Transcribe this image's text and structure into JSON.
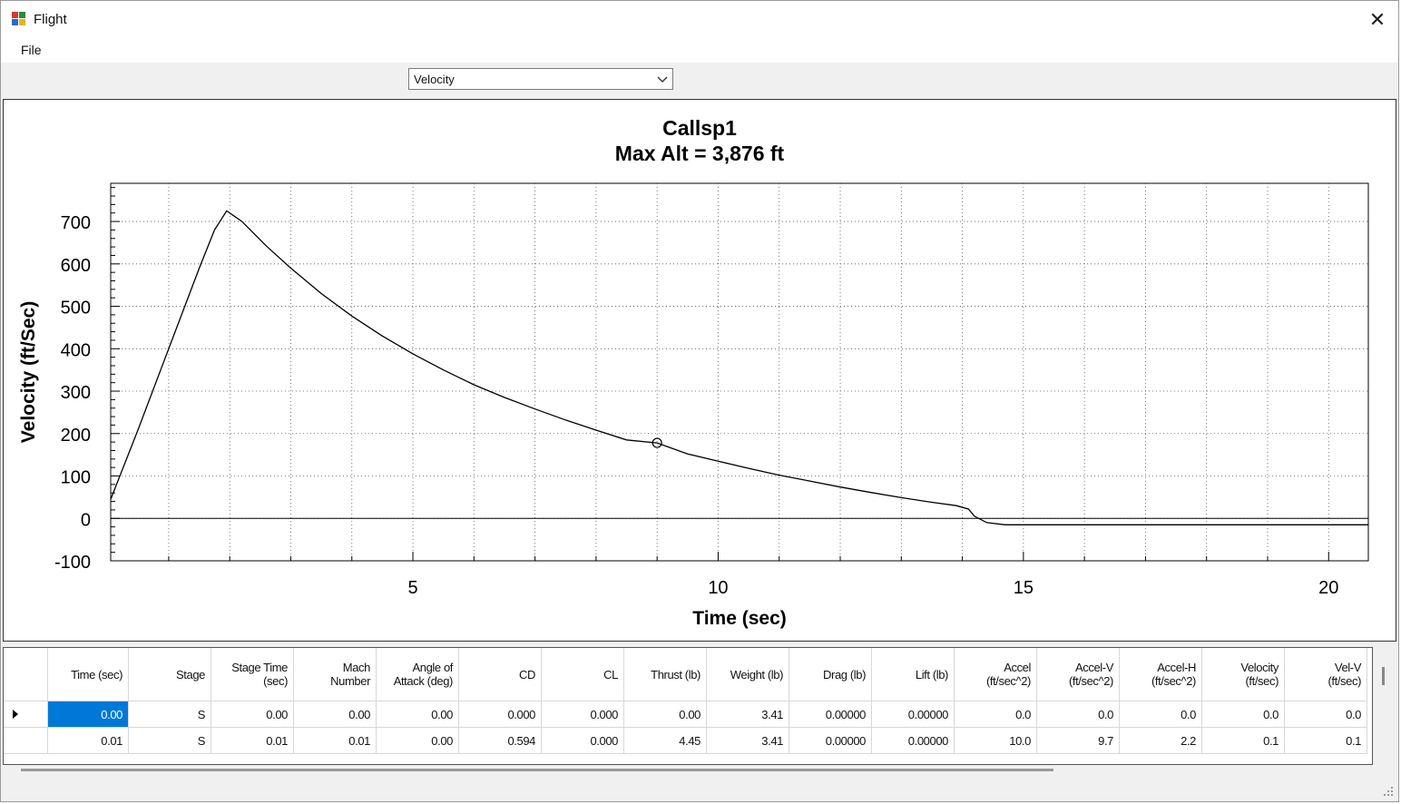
{
  "window": {
    "title": "Flight",
    "close_glyph": "✕"
  },
  "menu": {
    "file": "File"
  },
  "toolbar": {
    "plot_select": {
      "value": "Velocity"
    }
  },
  "chart_data": {
    "type": "line",
    "title": "Callsp1",
    "subtitle": "Max Alt = 3,876 ft",
    "xlabel": "Time (sec)",
    "ylabel": "Velocity (ft/Sec)",
    "xlim": [
      0.05,
      20.65
    ],
    "ylim": [
      -100,
      790
    ],
    "x_ticks": [
      5,
      10,
      15,
      20
    ],
    "y_ticks": [
      -100,
      0,
      100,
      200,
      300,
      400,
      500,
      600,
      700
    ],
    "grid": true,
    "zero_line": true,
    "series": [
      {
        "x": [
          0.05,
          0.5,
          1.0,
          1.5,
          1.75,
          1.95,
          2.2,
          2.6,
          3.0,
          3.5,
          4.0,
          4.5,
          5.0,
          5.5,
          6.0,
          6.5,
          7.0,
          7.5,
          8.0,
          8.5,
          9.0,
          9.5,
          10.0,
          10.5,
          11.0,
          11.5,
          12.0,
          12.5,
          13.0,
          13.5,
          13.9,
          14.1,
          14.2,
          14.4,
          14.7,
          15.0,
          16.0,
          17.0,
          18.0,
          19.0,
          20.0,
          20.65
        ],
        "y": [
          45,
          210,
          400,
          590,
          680,
          725,
          700,
          642,
          590,
          530,
          477,
          430,
          388,
          350,
          315,
          285,
          258,
          232,
          208,
          185,
          178,
          152,
          135,
          118,
          102,
          88,
          74,
          61,
          49,
          38,
          30,
          22,
          5,
          -10,
          -15,
          -15,
          -15,
          -15,
          -15,
          -15,
          -15,
          -15
        ]
      }
    ],
    "marker": {
      "x": 9.0,
      "y": 178
    }
  },
  "grid_table": {
    "columns": [
      [
        "Time (sec)"
      ],
      [
        "Stage"
      ],
      [
        "Stage Time",
        "(sec)"
      ],
      [
        "Mach",
        "Number"
      ],
      [
        "Angle of",
        "Attack (deg)"
      ],
      [
        "CD"
      ],
      [
        "CL"
      ],
      [
        "Thrust (lb)"
      ],
      [
        "Weight (lb)"
      ],
      [
        "Drag (lb)"
      ],
      [
        "Lift (lb)"
      ],
      [
        "Accel",
        "(ft/sec^2)"
      ],
      [
        "Accel-V",
        "(ft/sec^2)"
      ],
      [
        "Accel-H",
        "(ft/sec^2)"
      ],
      [
        "Velocity",
        "(ft/sec)"
      ],
      [
        "Vel-V",
        "(ft/sec)"
      ]
    ],
    "rows": [
      [
        "0.00",
        "S",
        "0.00",
        "0.00",
        "0.00",
        "0.000",
        "0.000",
        "0.00",
        "3.41",
        "0.00000",
        "0.00000",
        "0.0",
        "0.0",
        "0.0",
        "0.0",
        "0.0"
      ],
      [
        "0.01",
        "S",
        "0.01",
        "0.01",
        "0.00",
        "0.594",
        "0.000",
        "4.45",
        "3.41",
        "0.00000",
        "0.00000",
        "10.0",
        "9.7",
        "2.2",
        "0.1",
        "0.1"
      ]
    ]
  }
}
